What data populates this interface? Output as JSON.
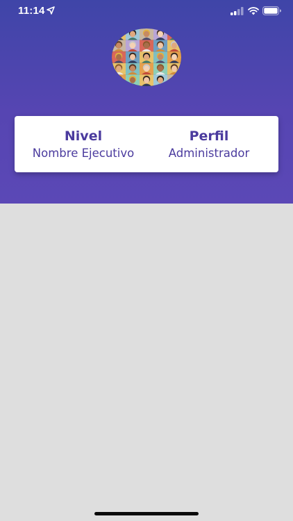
{
  "status_bar": {
    "time": "11:14",
    "icons": [
      "location-arrow-icon",
      "cellular-signal-icon",
      "wifi-icon",
      "battery-icon"
    ]
  },
  "profile": {
    "avatar_icon": "people-collage-avatar"
  },
  "info_card": {
    "level_title": "Nivel",
    "level_value": "Nombre Ejecutivo",
    "profile_title": "Perfil",
    "profile_value": "Administrador"
  },
  "colors": {
    "header_top": "#3f45a8",
    "header_bottom": "#5b48b6",
    "accent_text": "#4b3b9e",
    "background": "#dedede"
  }
}
